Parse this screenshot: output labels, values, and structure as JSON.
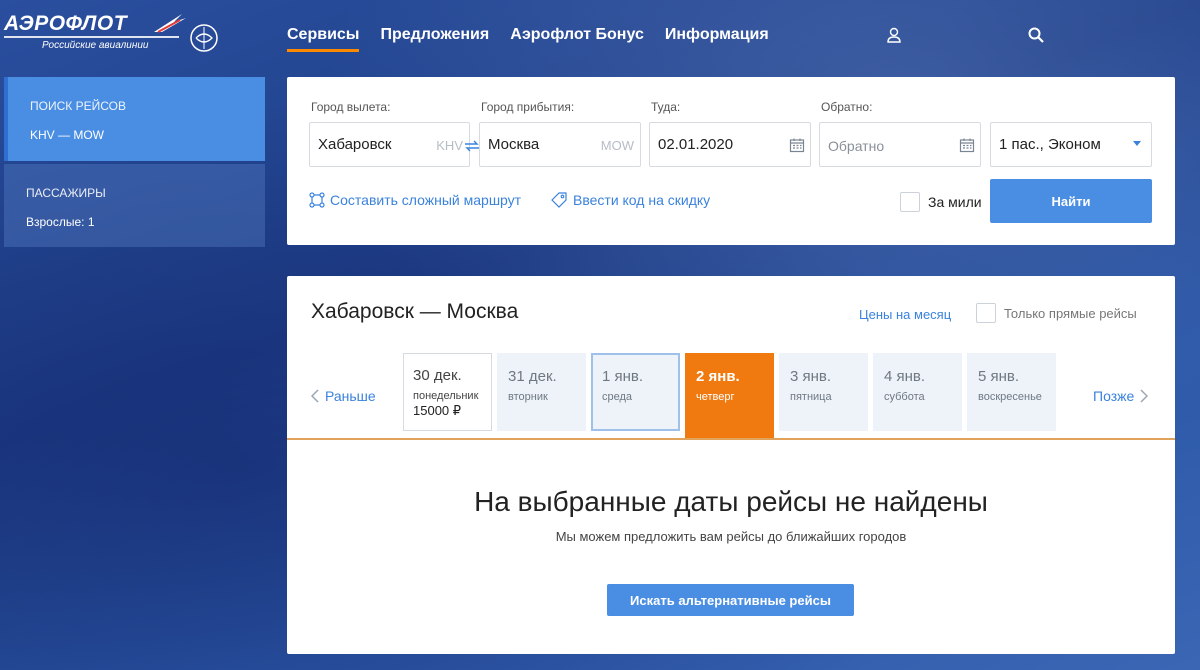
{
  "brand": {
    "name": "АЭРОФЛОТ",
    "subtitle": "Российские авиалинии"
  },
  "nav": {
    "items": [
      {
        "label": "Сервисы",
        "active": true
      },
      {
        "label": "Предложения",
        "active": false
      },
      {
        "label": "Аэрофлот Бонус",
        "active": false
      },
      {
        "label": "Информация",
        "active": false
      }
    ],
    "icons": [
      "user-icon",
      "search-icon"
    ]
  },
  "sidebar": {
    "search_title": "ПОИСК РЕЙСОВ",
    "search_route": "KHV — MOW",
    "passengers_title": "ПАССАЖИРЫ",
    "passengers_value": "Взрослые: 1"
  },
  "form": {
    "from_label": "Город вылета:",
    "from_value": "Хабаровск",
    "from_code": "KHV",
    "to_label": "Город прибытия:",
    "to_value": "Москва",
    "to_code": "MOW",
    "depart_label": "Туда:",
    "depart_value": "02.01.2020",
    "return_label": "Обратно:",
    "return_placeholder": "Обратно",
    "passengers_value": "1 пас., Эконом",
    "complex_route": "Составить сложный маршрут",
    "promo_code": "Ввести код на скидку",
    "miles_label": "За мили",
    "find_button": "Найти"
  },
  "results": {
    "route_title": "Хабаровск — Москва",
    "month_prices": "Цены на месяц",
    "direct_only": "Только прямые рейсы",
    "prev_label": "Раньше",
    "next_label": "Позже",
    "days": [
      {
        "date": "30 дек.",
        "weekday": "понедельник",
        "price": "15000 ₽",
        "state": "price"
      },
      {
        "date": "31 дек.",
        "weekday": "вторник",
        "price": "",
        "state": "normal"
      },
      {
        "date": "1 янв.",
        "weekday": "среда",
        "price": "",
        "state": "outline"
      },
      {
        "date": "2 янв.",
        "weekday": "четверг",
        "price": "",
        "state": "selected"
      },
      {
        "date": "3 янв.",
        "weekday": "пятница",
        "price": "",
        "state": "normal"
      },
      {
        "date": "4 янв.",
        "weekday": "суббота",
        "price": "",
        "state": "normal"
      },
      {
        "date": "5 янв.",
        "weekday": "воскресенье",
        "price": "",
        "state": "normal"
      }
    ],
    "empty_title": "На выбранные даты рейсы не найдены",
    "empty_subtitle": "Мы можем предложить вам рейсы до ближайших городов",
    "alt_button": "Искать альтернативные рейсы"
  },
  "colors": {
    "accent_blue": "#4a8ee4",
    "link_blue": "#3a82dd",
    "selected_orange": "#f07a10",
    "nav_underline": "#ff8a00"
  }
}
